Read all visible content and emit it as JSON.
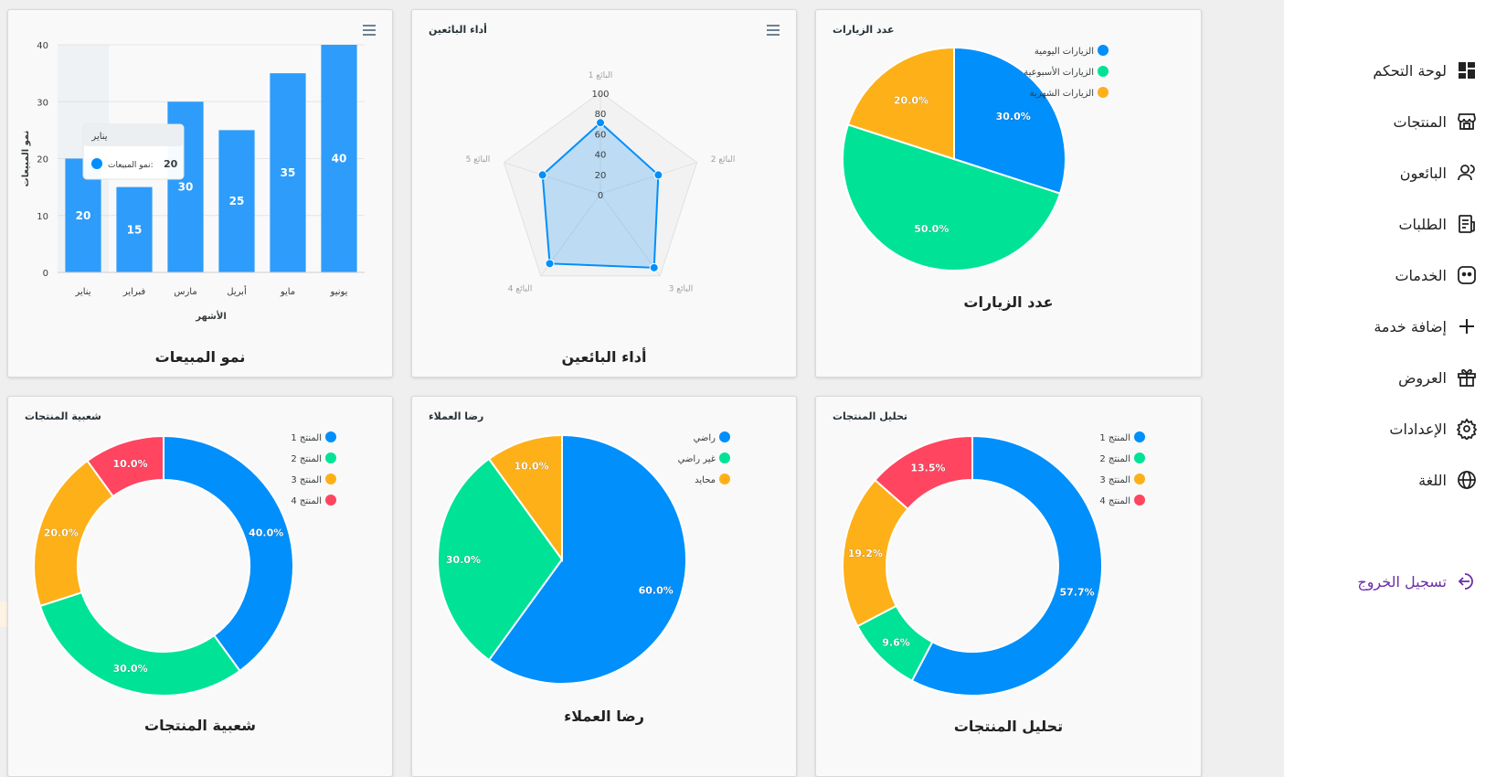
{
  "sidebar": {
    "items": [
      {
        "label": "لوحة التحكم",
        "icon": "dashboard-icon"
      },
      {
        "label": "المنتجات",
        "icon": "store-icon"
      },
      {
        "label": "البائعون",
        "icon": "user-icon"
      },
      {
        "label": "الطلبات",
        "icon": "orders-icon"
      },
      {
        "label": "الخدمات",
        "icon": "services-icon"
      },
      {
        "label": "إضافة خدمة",
        "icon": "plus-icon"
      },
      {
        "label": "العروض",
        "icon": "gift-icon"
      },
      {
        "label": "الإعدادات",
        "icon": "gear-icon"
      },
      {
        "label": "اللغة",
        "icon": "globe-icon"
      }
    ],
    "logout": {
      "label": "تسجيل الخروج",
      "icon": "logout-icon"
    }
  },
  "colors": {
    "blue": "#008FFB",
    "green": "#00E396",
    "orange": "#FEB019",
    "red": "#FF4560",
    "bar": "#2E9CFA",
    "logout": "#6b2fa8"
  },
  "cards": {
    "visits": {
      "caption": "عدد الزيارات"
    },
    "sellers": {
      "caption": "أداء البائعين"
    },
    "sales": {
      "caption": "نمو المبيعات"
    },
    "analysis": {
      "caption": "تحليل المنتجات"
    },
    "satisfaction": {
      "caption": "رضا العملاء"
    },
    "popularity": {
      "caption": "شعبية المنتجات"
    }
  },
  "chart_data": [
    {
      "id": "visits",
      "type": "pie",
      "title": "عدد الزيارات",
      "categories": [
        "الزيارات اليومية",
        "الزيارات الأسبوعية",
        "الزيارات الشهرية"
      ],
      "values": [
        30,
        50,
        20
      ],
      "labels": [
        "30.0%",
        "50.0%",
        "20.0%"
      ],
      "legend": "top-right"
    },
    {
      "id": "sellers",
      "type": "radar",
      "title": "أداء البائعين",
      "categories": [
        "البائع 1",
        "البائع 2",
        "البائع 3",
        "البائع 4",
        "البائع 5"
      ],
      "values": [
        70,
        60,
        90,
        85,
        60
      ],
      "ticks": [
        "0",
        "20",
        "40",
        "60",
        "80",
        "100"
      ],
      "ylim": [
        0,
        100
      ]
    },
    {
      "id": "sales",
      "type": "bar",
      "title": "",
      "categories": [
        "يناير",
        "فبراير",
        "مارس",
        "أبريل",
        "مايو",
        "يونيو"
      ],
      "values": [
        20,
        15,
        30,
        25,
        35,
        40
      ],
      "xlabel": "الأشهر",
      "ylabel": "نمو المبيعات",
      "ylim": [
        0,
        40
      ],
      "yticks": [
        "0",
        "10",
        "20",
        "30",
        "40"
      ],
      "tooltip": {
        "title": "يناير",
        "series": "نمو المبيعات:",
        "value": "20"
      }
    },
    {
      "id": "analysis",
      "type": "pie",
      "variant": "donut",
      "title": "تحليل المنتجات",
      "categories": [
        "المنتج 1",
        "المنتج 2",
        "المنتج 3",
        "المنتج 4"
      ],
      "values": [
        57.7,
        9.6,
        19.2,
        13.5
      ],
      "labels": [
        "57.7%",
        "9.6%",
        "19.2%",
        "13.5%"
      ],
      "legend": "top-right"
    },
    {
      "id": "satisfaction",
      "type": "pie",
      "title": "رضا العملاء",
      "categories": [
        "راضي",
        "غير راضي",
        "محايد"
      ],
      "values": [
        60,
        30,
        10
      ],
      "labels": [
        "60.0%",
        "30.0%",
        "10.0%"
      ],
      "legend": "top-right"
    },
    {
      "id": "popularity",
      "type": "pie",
      "variant": "donut",
      "title": "شعبية المنتجات",
      "categories": [
        "المنتج 1",
        "المنتج 2",
        "المنتج 3",
        "المنتج 4"
      ],
      "values": [
        40,
        30,
        20,
        10
      ],
      "labels": [
        "40.0%",
        "30.0%",
        "20.0%",
        "10.0%"
      ],
      "legend": "top-right"
    }
  ]
}
